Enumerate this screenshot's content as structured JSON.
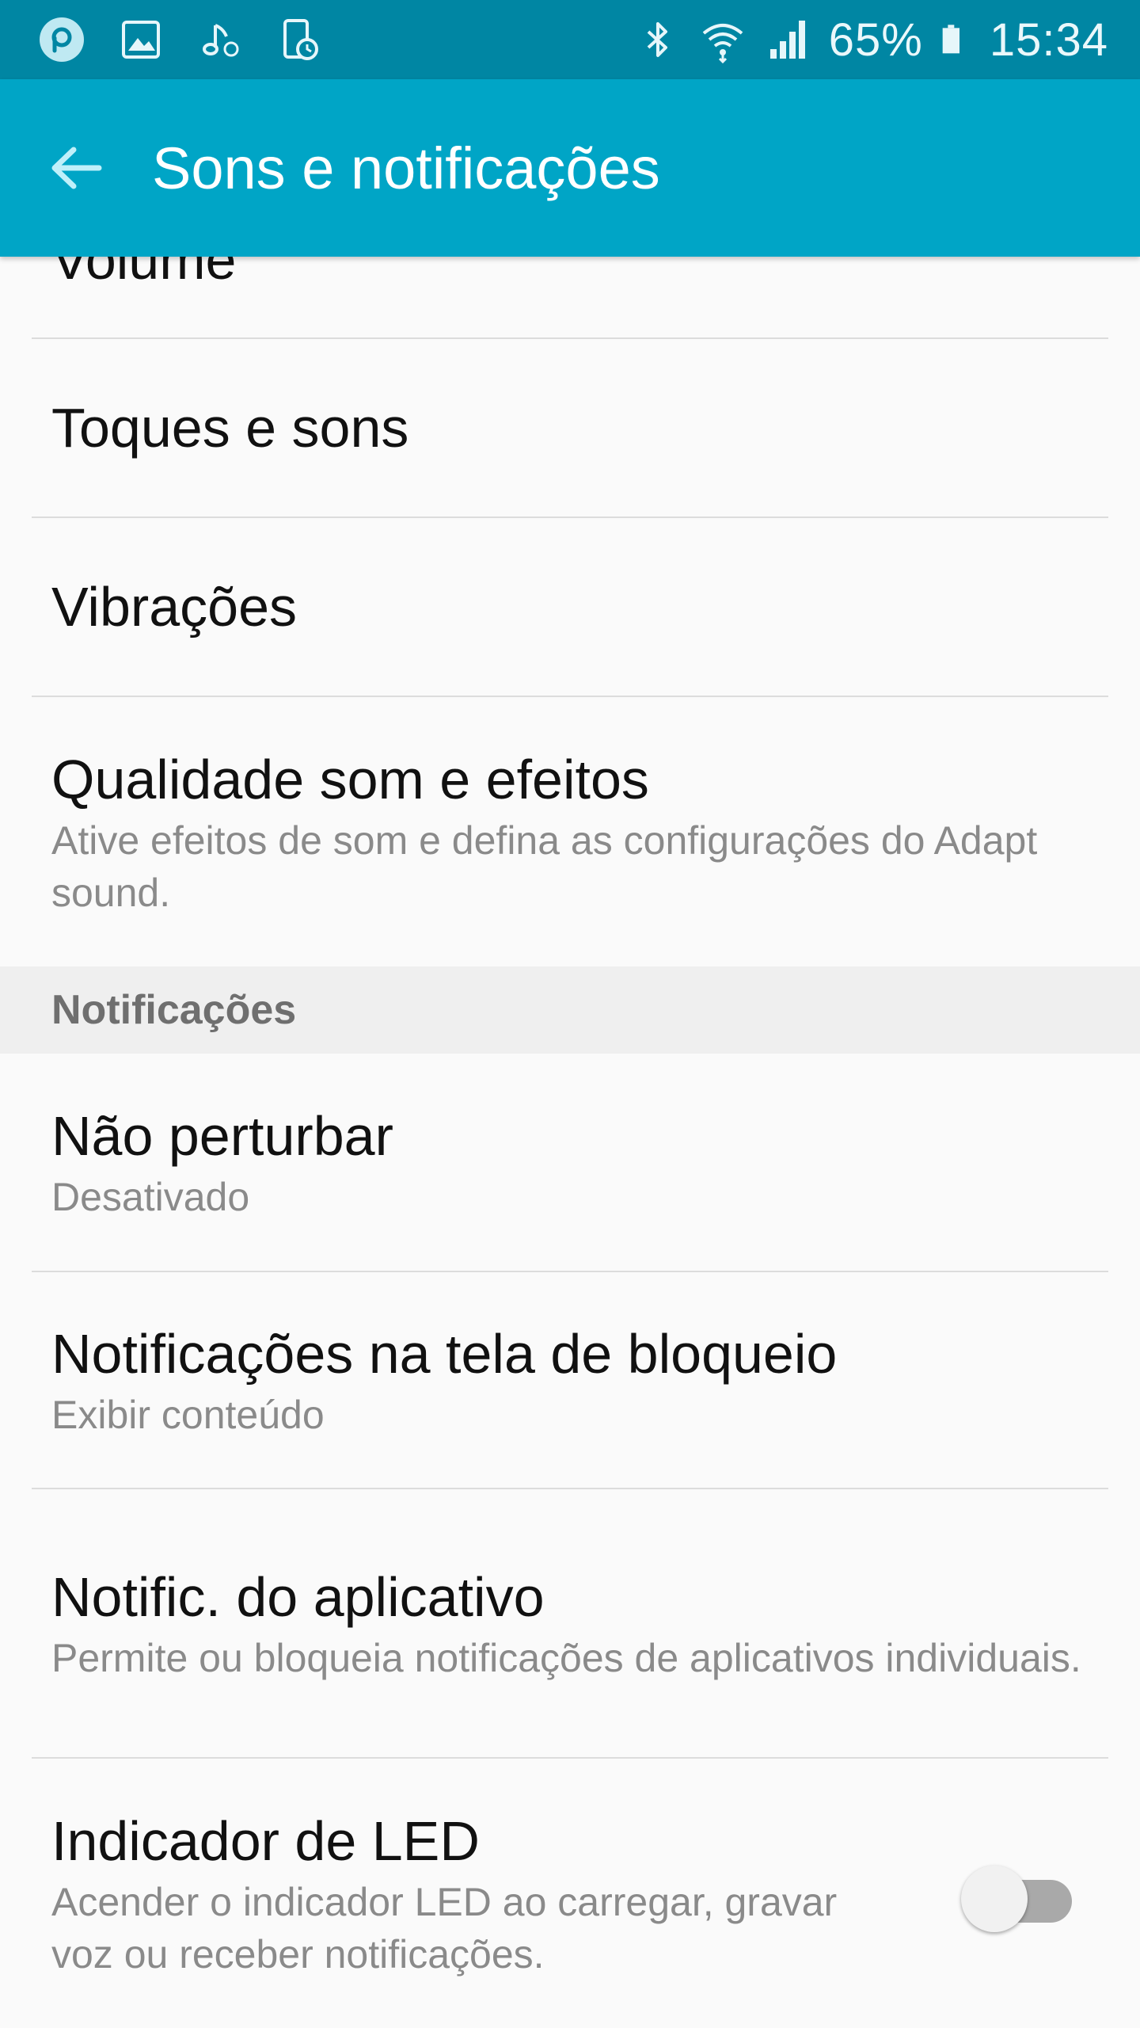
{
  "status_bar": {
    "battery": "65%",
    "time": "15:34",
    "left_icons": [
      "p-badge-icon",
      "gallery-icon",
      "music-icon",
      "screen-timer-icon"
    ],
    "right_icons": [
      "bluetooth-icon",
      "wifi-icon",
      "signal-icon",
      "battery-icon"
    ]
  },
  "app_bar": {
    "title": "Sons e notificações"
  },
  "list": {
    "partial_item": "Volume",
    "items": [
      {
        "title": "Toques e sons"
      },
      {
        "title": "Vibrações"
      },
      {
        "title": "Qualidade som e efeitos",
        "subtitle": "Ative efeitos de som e defina as configurações do Adapt sound."
      }
    ],
    "section_header": "Notificações",
    "notification_items": [
      {
        "title": "Não perturbar",
        "subtitle": "Desativado"
      },
      {
        "title": "Notificações na tela de bloqueio",
        "subtitle": "Exibir conteúdo"
      },
      {
        "title": "Notific. do aplicativo",
        "subtitle": "Permite ou bloqueia notificações de aplicativos individuais."
      },
      {
        "title": "Indicador de LED",
        "subtitle": "Acender o indicador LED ao carregar, gravar voz ou receber notificações.",
        "toggle": "off"
      }
    ]
  },
  "colors": {
    "status_bar": "#0086a3",
    "app_bar": "#00a5c6",
    "background": "#fafafa",
    "section_header_bg": "#efefef"
  }
}
